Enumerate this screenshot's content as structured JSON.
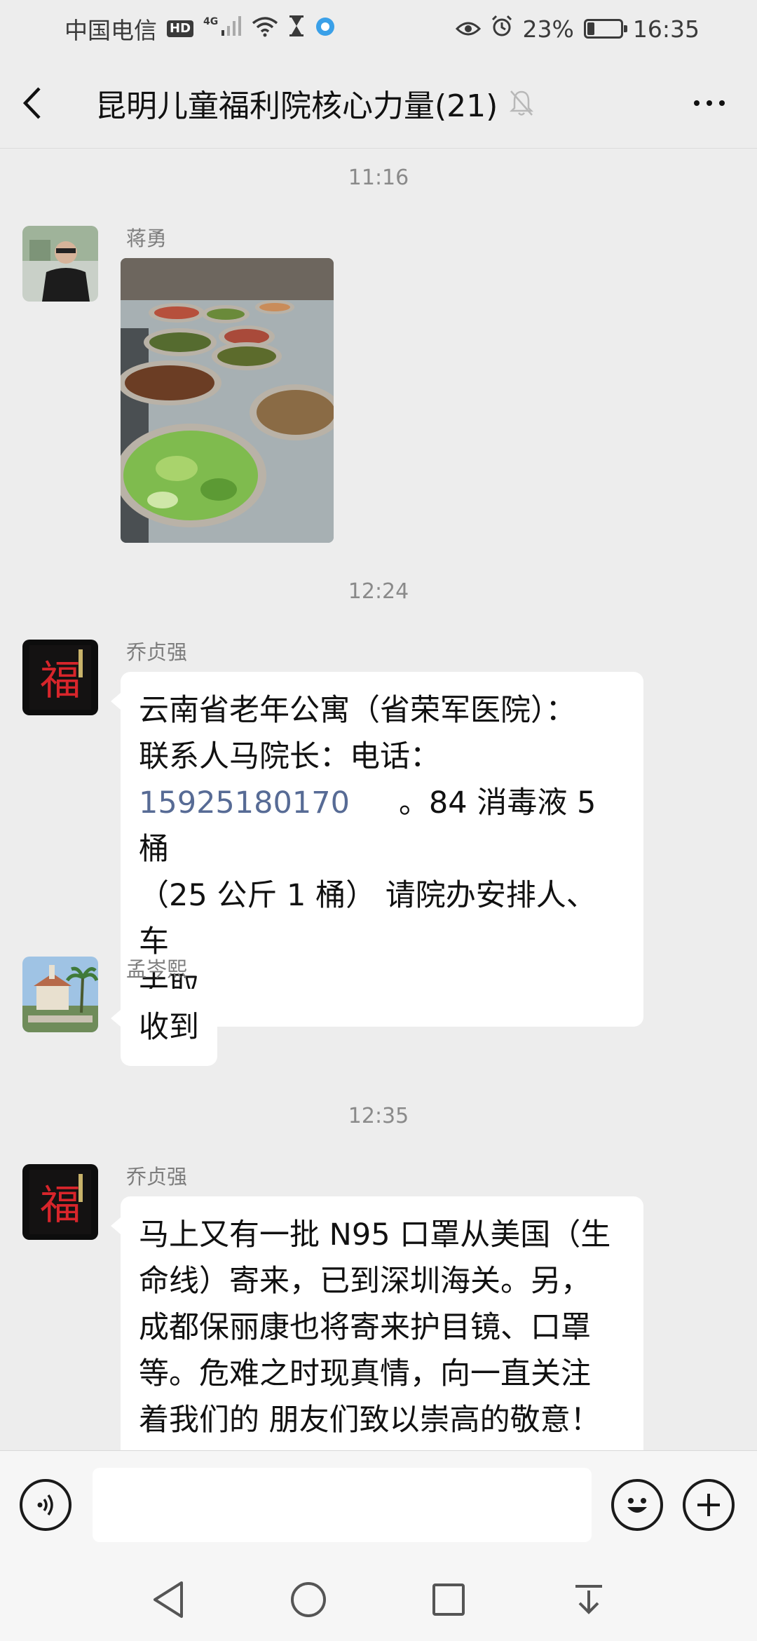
{
  "status_bar": {
    "carrier": "中国电信",
    "hd": "HD",
    "network": "4G",
    "battery": "23%",
    "battery_level": 0.23,
    "time": "16:35"
  },
  "header": {
    "title": "昆明儿童福利院核心力量(21)"
  },
  "messages": {
    "ts1": "11:16",
    "m1_sender": "蒋勇",
    "ts2": "12:24",
    "m2_sender": "乔贞强",
    "m2_line1": "云南省老年公寓（省荣军医院）：",
    "m2_line2": "联系人马院长：电话：",
    "m2_phone": "15925180170",
    "m2_line3_rest": "。84 消毒液 5 桶",
    "m2_line4": "（25 公斤 1 桶） 请院办安排人、车",
    "m2_line5": "去取。",
    "m3_sender": "孟岑熙",
    "m3_text": "收到",
    "ts3": "12:35",
    "m4_sender": "乔贞强",
    "m4_line1": "马上又有一批 N95 口罩从美国（生",
    "m4_line2": "命线）寄来，已到深圳海关。另，",
    "m4_line3": "成都保丽康也将寄来护目镜、口罩",
    "m4_line4": "等。危难之时现真情，向一直关注",
    "m4_line5": "着我们的 朋友们致以崇高的敬意！"
  },
  "icons": {
    "back": "chevron-left-icon",
    "mute": "bell-off-icon",
    "more": "more-dots-icon",
    "voice": "voice-icon",
    "emoji": "emoji-icon",
    "plus": "plus-icon"
  }
}
